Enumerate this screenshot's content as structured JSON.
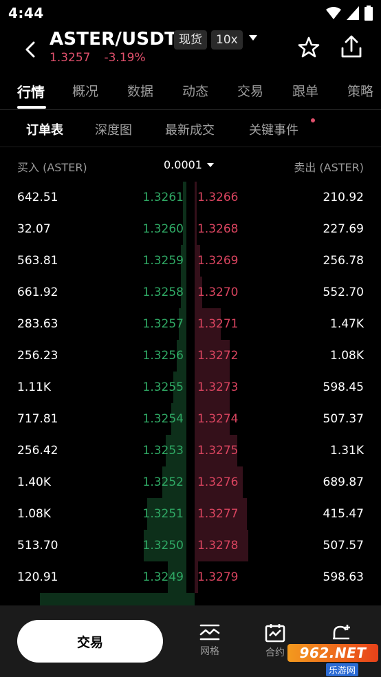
{
  "status": {
    "time": "4:44"
  },
  "header": {
    "pair": "ASTER/USDT",
    "tag_spot": "现货",
    "tag_leverage": "10x",
    "last_price": "1.3257",
    "change_pct": "-3.19%"
  },
  "tabs": [
    "行情",
    "概况",
    "数据",
    "动态",
    "交易",
    "跟单",
    "策略"
  ],
  "subtabs": [
    "订单表",
    "深度图",
    "最新成交",
    "关键事件"
  ],
  "book_header": {
    "bid_label": "买入 (ASTER)",
    "precision": "0.0001",
    "ask_label": "卖出 (ASTER)"
  },
  "order_book": [
    {
      "bid_qty": "642.51",
      "bid_price": "1.3261",
      "ask_price": "1.3266",
      "ask_qty": "210.92",
      "bid_depth": 0.02,
      "ask_depth": 0.01
    },
    {
      "bid_qty": "32.07",
      "bid_price": "1.3260",
      "ask_price": "1.3268",
      "ask_qty": "227.69",
      "bid_depth": 0.02,
      "ask_depth": 0.01
    },
    {
      "bid_qty": "563.81",
      "bid_price": "1.3259",
      "ask_price": "1.3269",
      "ask_qty": "256.78",
      "bid_depth": 0.03,
      "ask_depth": 0.03
    },
    {
      "bid_qty": "661.92",
      "bid_price": "1.3258",
      "ask_price": "1.3270",
      "ask_qty": "552.70",
      "bid_depth": 0.03,
      "ask_depth": 0.04
    },
    {
      "bid_qty": "283.63",
      "bid_price": "1.3257",
      "ask_price": "1.3271",
      "ask_qty": "1.47K",
      "bid_depth": 0.04,
      "ask_depth": 0.14
    },
    {
      "bid_qty": "256.23",
      "bid_price": "1.3256",
      "ask_price": "1.3272",
      "ask_qty": "1.08K",
      "bid_depth": 0.05,
      "ask_depth": 0.19
    },
    {
      "bid_qty": "1.11K",
      "bid_price": "1.3255",
      "ask_price": "1.3273",
      "ask_qty": "598.45",
      "bid_depth": 0.07,
      "ask_depth": 0.19
    },
    {
      "bid_qty": "717.81",
      "bid_price": "1.3254",
      "ask_price": "1.3274",
      "ask_qty": "507.37",
      "bid_depth": 0.08,
      "ask_depth": 0.19
    },
    {
      "bid_qty": "256.42",
      "bid_price": "1.3253",
      "ask_price": "1.3275",
      "ask_qty": "1.31K",
      "bid_depth": 0.11,
      "ask_depth": 0.23
    },
    {
      "bid_qty": "1.40K",
      "bid_price": "1.3252",
      "ask_price": "1.3276",
      "ask_qty": "689.87",
      "bid_depth": 0.13,
      "ask_depth": 0.26
    },
    {
      "bid_qty": "1.08K",
      "bid_price": "1.3251",
      "ask_price": "1.3277",
      "ask_qty": "415.47",
      "bid_depth": 0.21,
      "ask_depth": 0.28
    },
    {
      "bid_qty": "513.70",
      "bid_price": "1.3250",
      "ask_price": "1.3278",
      "ask_qty": "507.57",
      "bid_depth": 0.23,
      "ask_depth": 0.29
    },
    {
      "bid_qty": "120.91",
      "bid_price": "1.3249",
      "ask_price": "1.3279",
      "ask_qty": "598.63",
      "bid_depth": 0.1,
      "ask_depth": 0.02
    }
  ],
  "footer": {
    "trade": "交易",
    "grid": "网格",
    "contract": "合约"
  },
  "watermark": {
    "logo": "962.NET",
    "sub": "乐游网"
  },
  "colors": {
    "bid": "#2fa864",
    "ask": "#d9445f",
    "bid_bar": "#0d2f1a",
    "ask_bar": "#34101a"
  }
}
